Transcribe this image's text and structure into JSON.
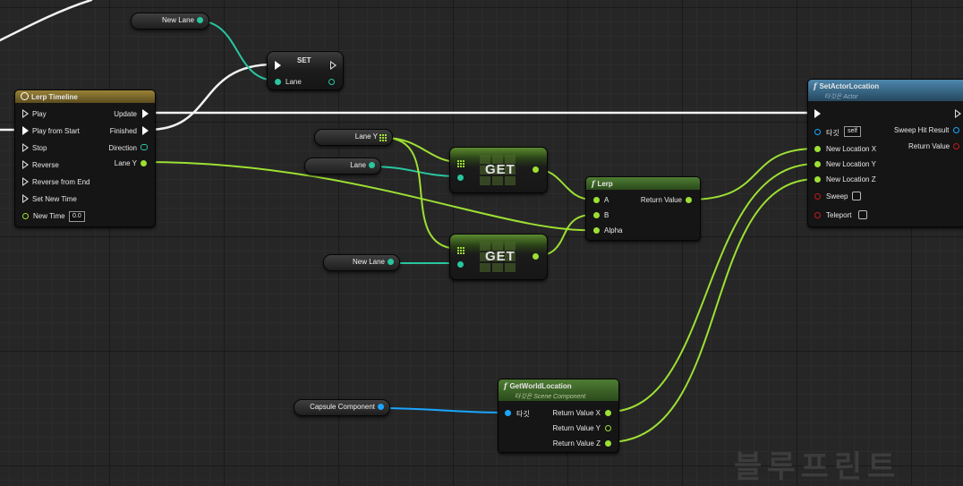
{
  "watermark": "블루프린트",
  "timeline": {
    "title": "Lerp Timeline",
    "inputs": [
      "Play",
      "Play from Start",
      "Stop",
      "Reverse",
      "Reverse from End",
      "Set New Time"
    ],
    "new_time_label": "New Time",
    "new_time_value": "0.0",
    "outputs": [
      "Update",
      "Finished",
      "Direction",
      "Lane Y"
    ]
  },
  "set_node": {
    "title": "SET",
    "pin": "Lane"
  },
  "vars": {
    "new_lane_top": "New Lane",
    "lane_y": "Lane Y",
    "lane": "Lane",
    "new_lane_mid": "New Lane",
    "capsule": "Capsule Component"
  },
  "get_nodes": {
    "label1": "GET",
    "label2": "GET"
  },
  "lerp": {
    "title": "Lerp",
    "a": "A",
    "b": "B",
    "alpha": "Alpha",
    "out": "Return Value"
  },
  "set_actor_location": {
    "title": "SetActorLocation",
    "subtitle": "타깃은 Actor",
    "target": "타깃",
    "target_value": "self",
    "new_x": "New Location X",
    "new_y": "New Location Y",
    "new_z": "New Location Z",
    "sweep": "Sweep",
    "teleport": "Teleport",
    "sweep_hit": "Sweep Hit Result",
    "return_value": "Return Value"
  },
  "get_world_location": {
    "title": "GetWorldLocation",
    "subtitle": "타깃은 Scene Component",
    "target": "타깃",
    "x": "Return Value X",
    "y": "Return Value Y",
    "z": "Return Value Z"
  },
  "colors": {
    "float_pin": "#9de033",
    "int_pin": "#29c6a0",
    "object_pin": "#1aa6ff",
    "function_header": "#3f6c88",
    "timeline_header": "#8a7330"
  }
}
